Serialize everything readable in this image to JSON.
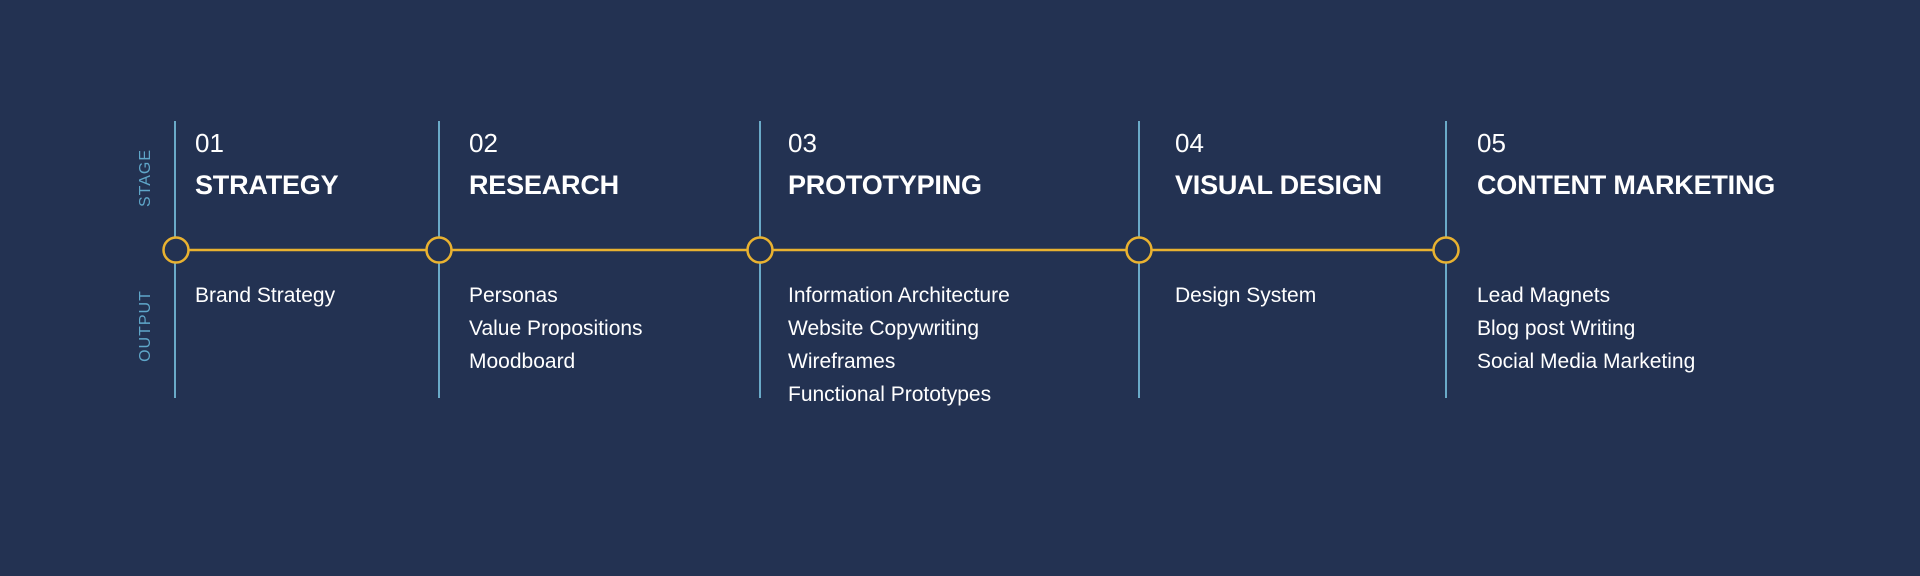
{
  "labels": {
    "stage_axis": "STAGE",
    "output_axis": "OUTPUT"
  },
  "colors": {
    "background": "#233252",
    "divider": "#6aaac8",
    "timeline": "#e9b230",
    "axis_label": "#5fa6c9",
    "text": "#ffffff"
  },
  "stages": [
    {
      "number": "01",
      "title": "STRATEGY",
      "outputs": [
        "Brand Strategy"
      ]
    },
    {
      "number": "02",
      "title": "RESEARCH",
      "outputs": [
        "Personas",
        "Value Propositions",
        "Moodboard"
      ]
    },
    {
      "number": "03",
      "title": "PROTOTYPING",
      "outputs": [
        "Information Architecture",
        "Website Copywriting",
        "Wireframes",
        "Functional Prototypes"
      ]
    },
    {
      "number": "04",
      "title": "VISUAL DESIGN",
      "outputs": [
        "Design System"
      ]
    },
    {
      "number": "05",
      "title": "CONTENT MARKETING",
      "outputs": [
        "Lead Magnets",
        "Blog post Writing",
        "Social Media Marketing"
      ]
    }
  ]
}
